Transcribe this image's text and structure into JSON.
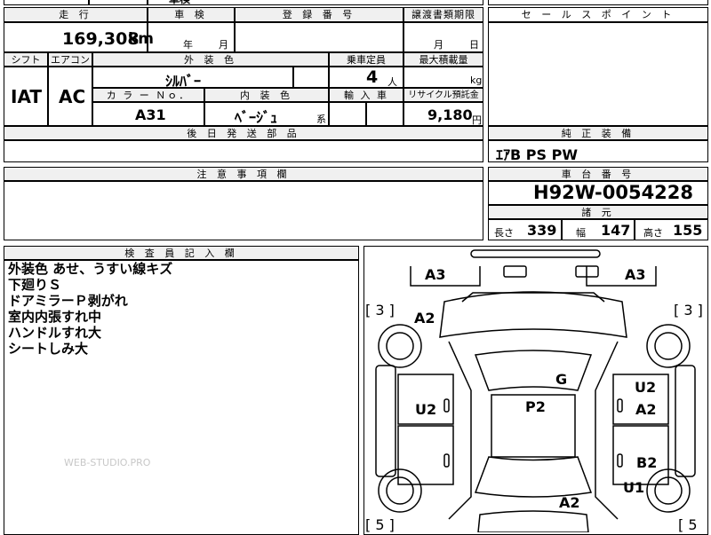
{
  "top_fragment": {
    "shaken_label": "車検"
  },
  "mileage": {
    "header": "走 行",
    "value": "169,308",
    "unit": "km"
  },
  "inspection": {
    "header": "車 検",
    "year_label": "年",
    "month_label": "月"
  },
  "registration": {
    "header": "登 録 番 号",
    "value": ""
  },
  "transfer_deadline": {
    "header": "譲渡書類期限",
    "month_label": "月",
    "day_label": "日"
  },
  "sales_point": {
    "header": "セ ー ル ス ポ イ ン ト",
    "value": ""
  },
  "shift": {
    "header": "シフト",
    "value": "IAT"
  },
  "aircon": {
    "header": "エアコン",
    "value": "AC"
  },
  "exterior_color": {
    "header": "外 装 色",
    "value": "ｼﾙﾊﾞｰ"
  },
  "capacity": {
    "header": "乗車定員",
    "value": "4",
    "unit": "人"
  },
  "max_load": {
    "header": "最大積載量",
    "unit": "kg"
  },
  "color_no": {
    "header": "カ ラ ー Ｎｏ．",
    "value": "A31"
  },
  "interior_color": {
    "header": "内 装 色",
    "value": "ﾍﾞｰｼﾞｭ",
    "suffix": "系"
  },
  "import": {
    "header": "輸 入 車"
  },
  "recycle": {
    "header": "リサイクル預託金",
    "value": "9,180",
    "unit": "円"
  },
  "delivery_parts": {
    "header": "後 日 発 送 部 品"
  },
  "genuine_equipment": {
    "header": "純 正 装 備",
    "value": "ｴｱB PS PW"
  },
  "caution": {
    "header": "注 意 事 項 欄"
  },
  "chassis_number": {
    "header": "車 台 番 号",
    "value": "H92W-0054228"
  },
  "specs": {
    "header": "諸 元",
    "length_label": "長さ",
    "length": "339",
    "width_label": "幅",
    "width": "147",
    "height_label": "高さ",
    "height": "155"
  },
  "inspector_notes": {
    "header": "検 査 員 記 入 欄",
    "lines": [
      "外装色 あせ、うすい線キズ",
      "下廻りＳ",
      "ドアミラーＰ剥がれ",
      "室内内張すれ中",
      "ハンドルすれ大",
      "シートしみ大"
    ]
  },
  "watermark": "WEB-STUDIO.PRO",
  "diagram": {
    "left_top_grade": "[ 3 ]",
    "right_top_grade": "[ 3 ]",
    "left_bottom_grade": "[ 5 ]",
    "right_bottom_grade": "[ 5",
    "marks": {
      "a3_left": "A3",
      "a3_right": "A3",
      "a2_front": "A2",
      "g": "G",
      "u2_right_top": "U2",
      "u2_left": "U2",
      "p2": "P2",
      "a2_right": "A2",
      "b2": "B2",
      "u1": "U1",
      "a2_rear": "A2"
    }
  }
}
